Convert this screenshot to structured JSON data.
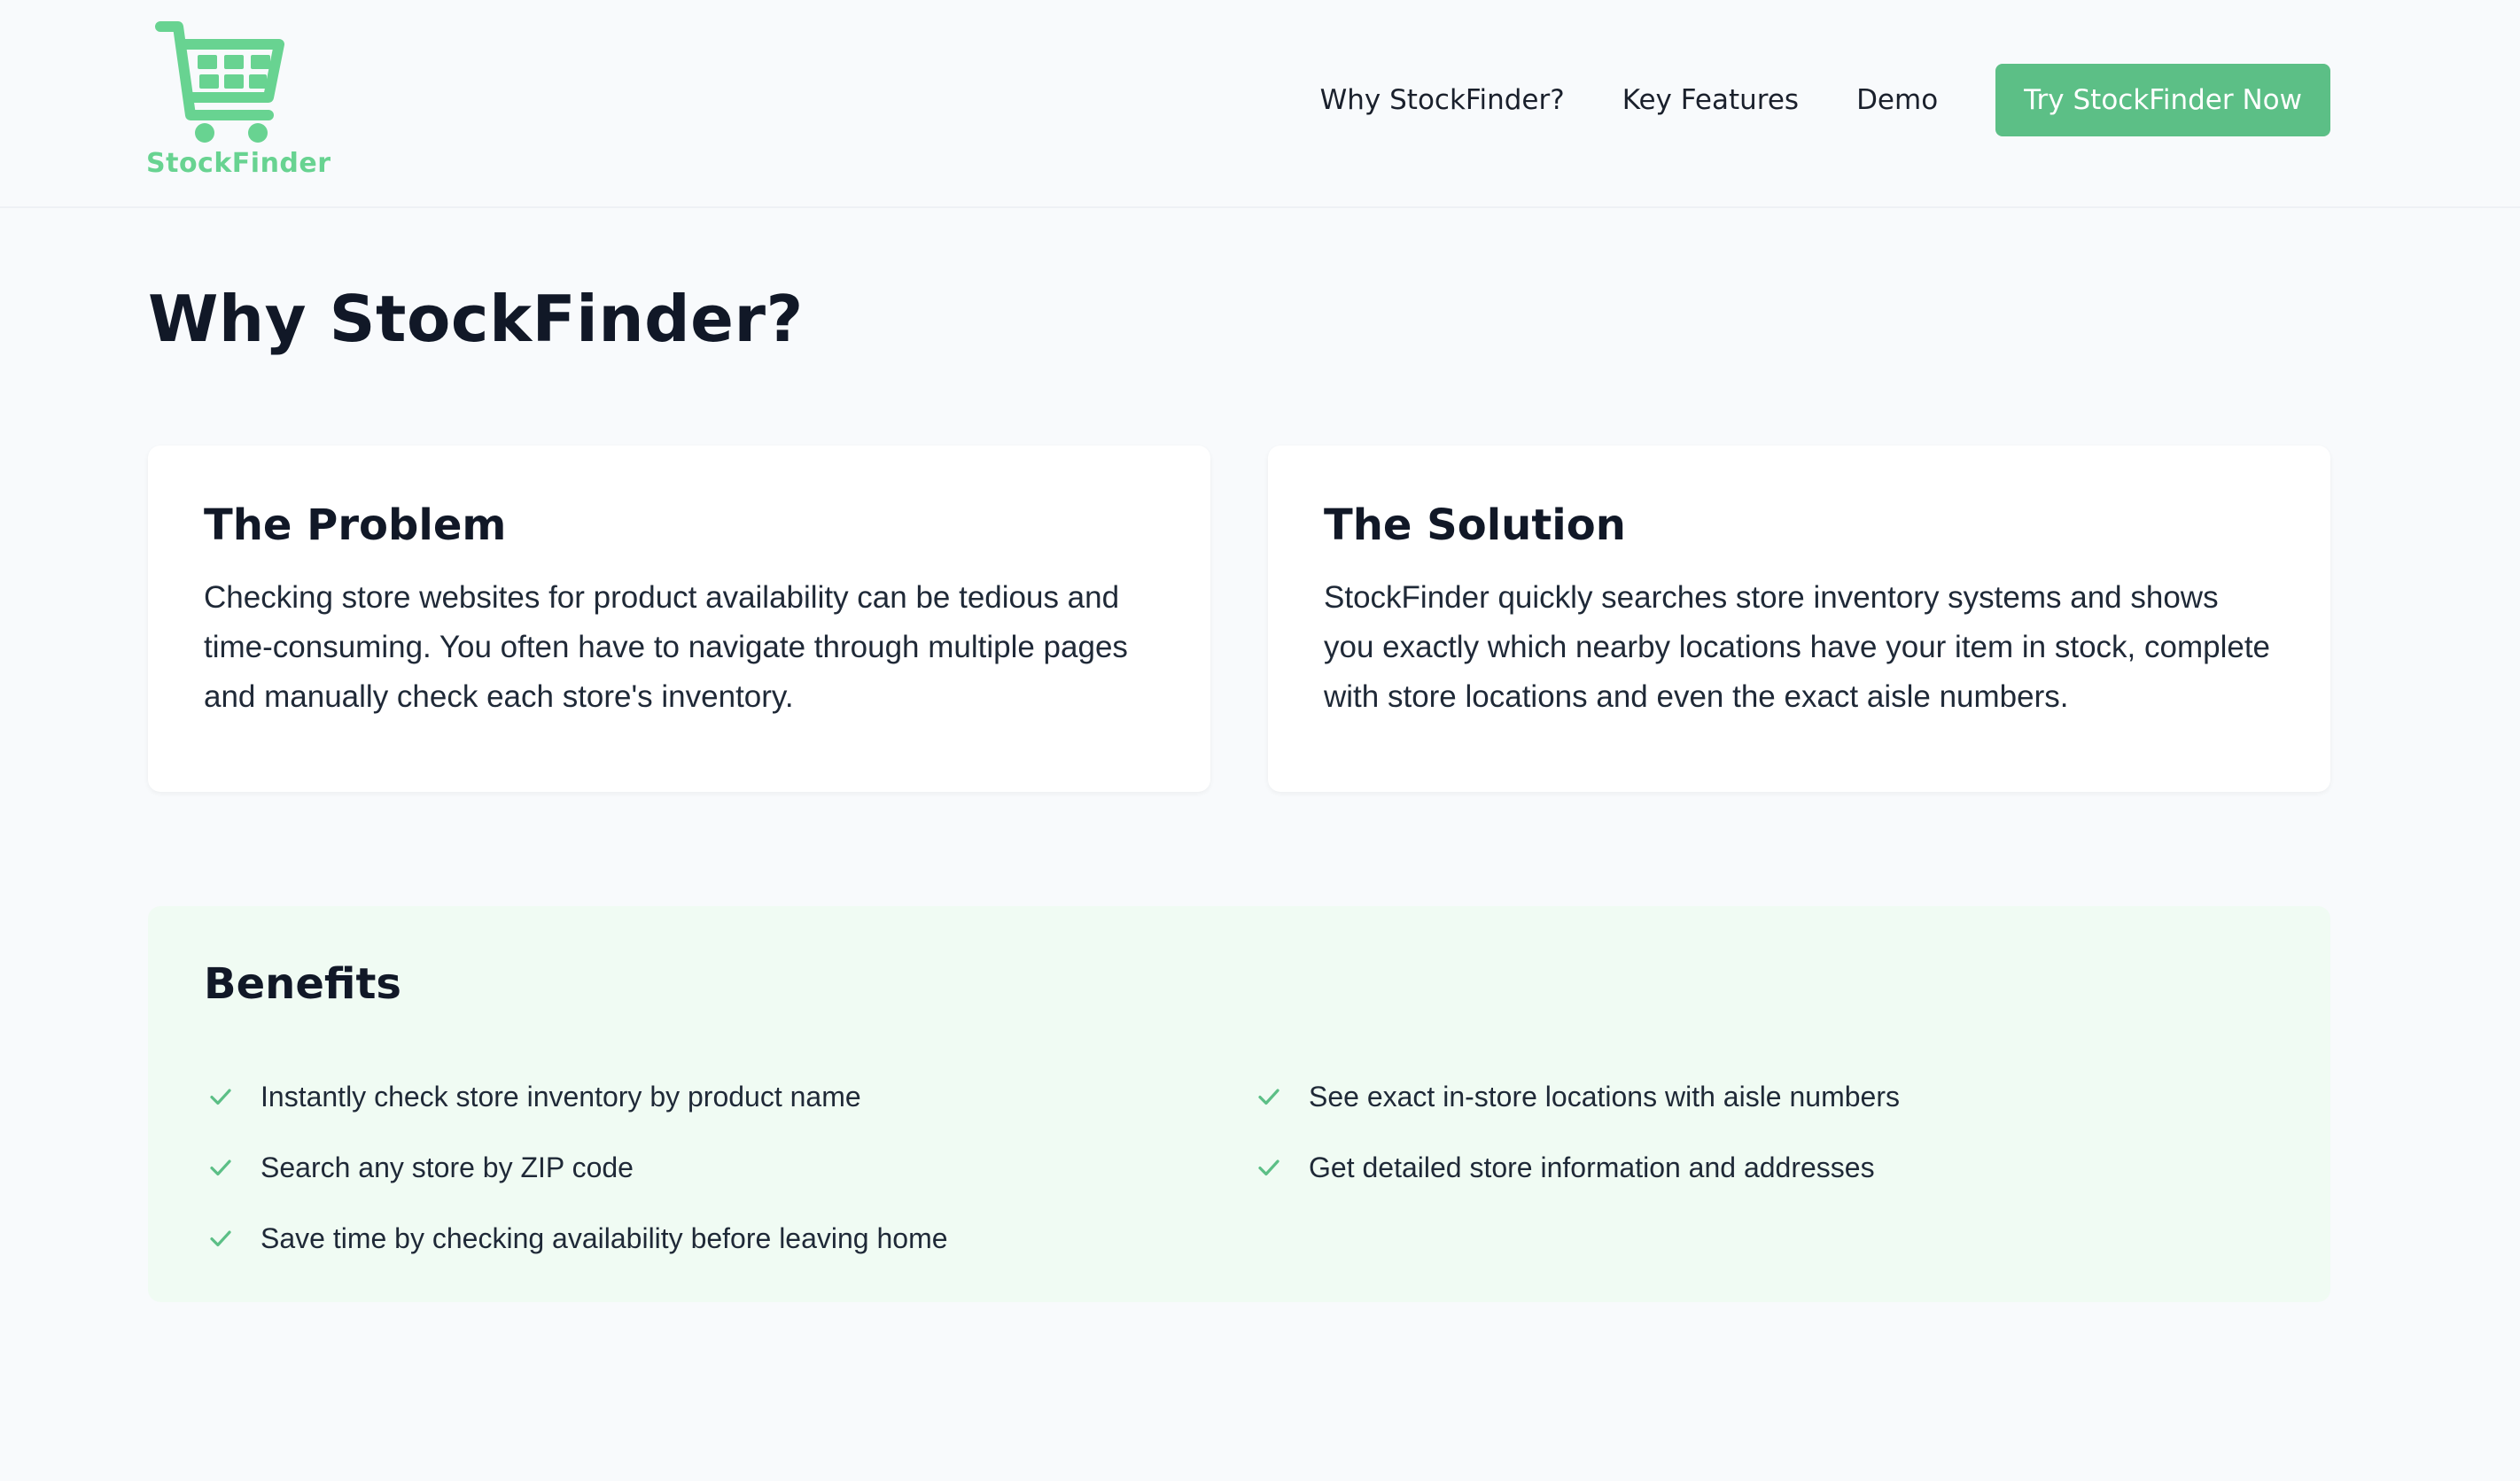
{
  "brand": {
    "name": "StockFinder",
    "accent_color": "#68d391",
    "button_color": "#5cbf86"
  },
  "nav": {
    "links": [
      "Why StockFinder?",
      "Key Features",
      "Demo"
    ],
    "cta_label": "Try StockFinder Now"
  },
  "main": {
    "title": "Why StockFinder?",
    "cards": [
      {
        "title": "The Problem",
        "body": "Checking store websites for product availability can be tedious and time-consuming. You often have to navigate through multiple pages and manually check each store's inventory."
      },
      {
        "title": "The Solution",
        "body": "StockFinder quickly searches store inventory systems and shows you exactly which nearby locations have your item in stock, complete with store locations and even the exact aisle numbers."
      }
    ],
    "benefits": {
      "title": "Benefits",
      "check_icon": "checkmark-icon",
      "left": [
        "Instantly check store inventory by product name",
        "Search any store by ZIP code",
        "Save time by checking availability before leaving home"
      ],
      "right": [
        "See exact in-store locations with aisle numbers",
        "Get detailed store information and addresses"
      ]
    }
  }
}
